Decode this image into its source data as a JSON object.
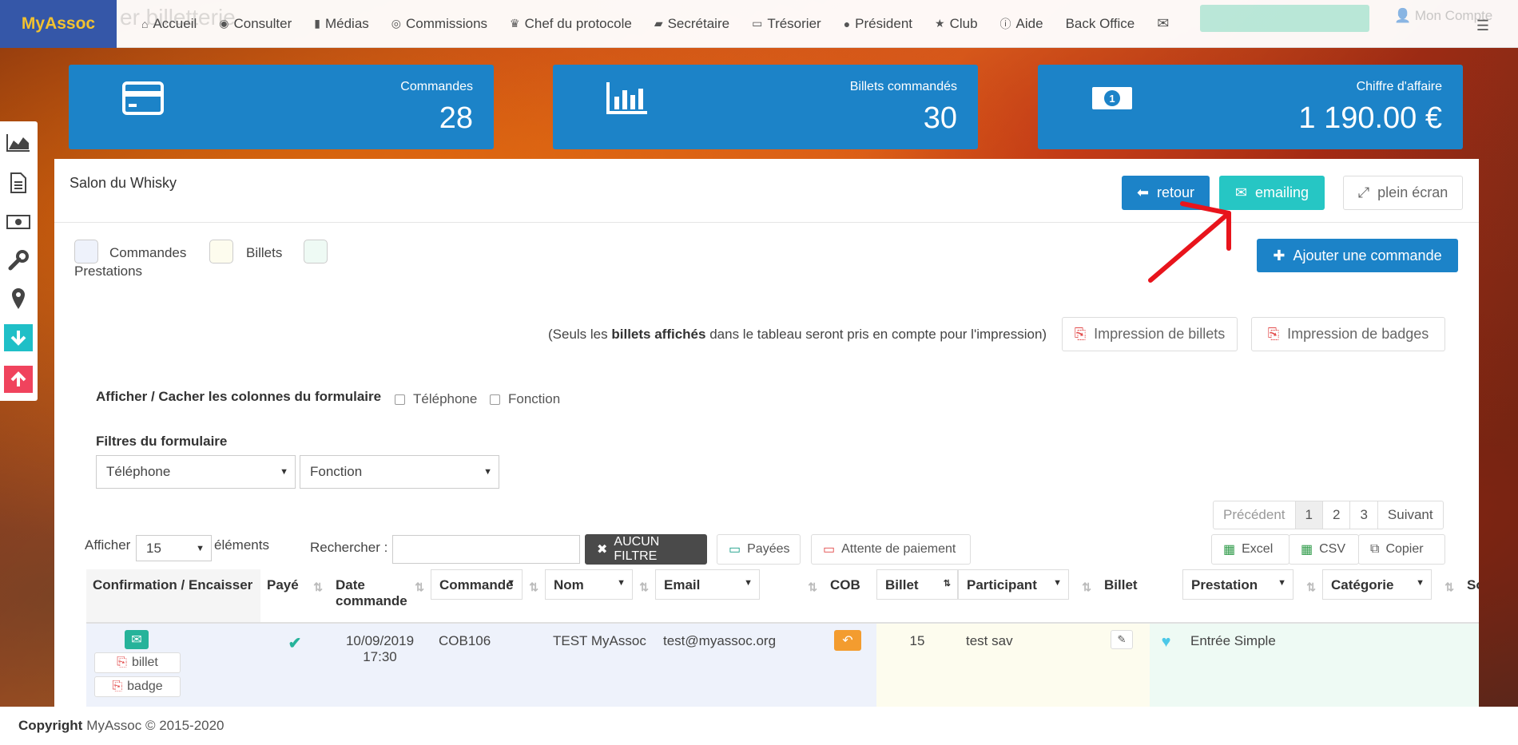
{
  "nav": {
    "brand": "MyAssoc",
    "ghost_title": "er billetterie",
    "items": [
      {
        "label": "Accueil",
        "icon": "home-icon"
      },
      {
        "label": "Consulter",
        "icon": "eye-icon"
      },
      {
        "label": "Médias",
        "icon": "file-icon"
      },
      {
        "label": "Commissions",
        "icon": "user-circle-icon"
      },
      {
        "label": "Chef du protocole",
        "icon": "trophy-icon"
      },
      {
        "label": "Secrétaire",
        "icon": "book-icon"
      },
      {
        "label": "Trésorier",
        "icon": "money-icon"
      },
      {
        "label": "Président",
        "icon": "globe-icon"
      },
      {
        "label": "Club",
        "icon": "star-icon"
      },
      {
        "label": "Aide",
        "icon": "info-icon"
      },
      {
        "label": "Back Office",
        "icon": ""
      }
    ],
    "ghost_account": "Mon Compte"
  },
  "stats": {
    "orders": {
      "label": "Commandes",
      "value": "28"
    },
    "tickets": {
      "label": "Billets commandés",
      "value": "30"
    },
    "revenue": {
      "label": "Chiffre d'affaire",
      "value": "1 190.00 €"
    }
  },
  "panel": {
    "title": "Salon du Whisky",
    "back_label": "retour",
    "emailing_label": "emailing",
    "fullscreen_label": "plein écran",
    "add_order_label": "Ajouter une commande",
    "legend": {
      "orders": "Commandes",
      "tickets": "Billets",
      "services": "Prestations"
    },
    "print_note_pre": "(Seuls les ",
    "print_note_bold": "billets affichés",
    "print_note_post": " dans le tableau seront pris en compte pour l'impression)",
    "print_tickets_label": "Impression de billets",
    "print_badges_label": "Impression de badges",
    "columns_toggle_label": "Afficher / Cacher les colonnes du formulaire",
    "col_phone": "Téléphone",
    "col_function": "Fonction",
    "filters_label": "Filtres du formulaire",
    "filter_phone": "Téléphone",
    "filter_function": "Fonction",
    "pager": {
      "prev": "Précédent",
      "pages": [
        "1",
        "2",
        "3"
      ],
      "next": "Suivant"
    },
    "show_label": "Afficher",
    "show_value": "15",
    "elements_label": "éléments",
    "search_label": "Rechercher :",
    "search_value": "",
    "no_filter_label": "AUCUN FILTRE",
    "paid_label": "Payées",
    "pending_label": "Attente de paiement",
    "excel_label": "Excel",
    "csv_label": "CSV",
    "copy_label": "Copier"
  },
  "table": {
    "headers": {
      "confirm": "Confirmation / Encaisser",
      "paid": "Payé",
      "date": "Date commande",
      "order": "Commande",
      "name": "Nom",
      "email": "Email",
      "cob": "COB",
      "ticket_no": "Billet",
      "participant": "Participant",
      "ticket": "Billet",
      "service": "Prestation",
      "category": "Catégorie",
      "sub": "Sou"
    },
    "row": {
      "ticket_btn": "billet",
      "badge_btn": "badge",
      "date": "10/09/2019 17:30",
      "order": "COB106",
      "name": "TEST MyAssoc",
      "email": "test@myassoc.org",
      "ticket_no": "15",
      "participant": "test sav",
      "service": "Entrée Simple"
    }
  },
  "footer": {
    "copyright": "Copyright",
    "text": "MyAssoc © 2015-2020"
  },
  "colors": {
    "primary": "#1c83c8",
    "teal": "#26c6c4",
    "brand_bg": "#3557a8",
    "brand_text": "#f2c230",
    "arrow": "#e8141c"
  }
}
